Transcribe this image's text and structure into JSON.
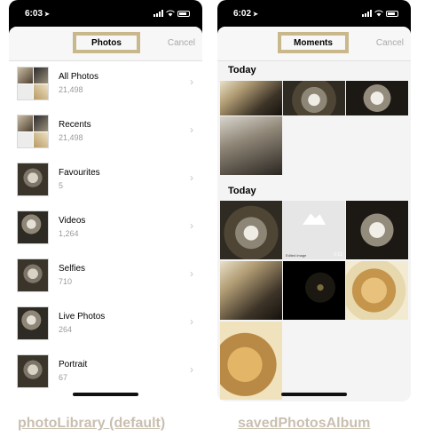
{
  "left_screen": {
    "status": {
      "time": "6:03",
      "location_glyph": "➤"
    },
    "title": "Photos",
    "cancel_label": "Cancel",
    "albums": [
      {
        "name": "All Photos",
        "count": "21,498"
      },
      {
        "name": "Recents",
        "count": "21,498"
      },
      {
        "name": "Favourites",
        "count": "5"
      },
      {
        "name": "Videos",
        "count": "1,264"
      },
      {
        "name": "Selfies",
        "count": "710"
      },
      {
        "name": "Live Photos",
        "count": "264"
      },
      {
        "name": "Portrait",
        "count": "67"
      }
    ],
    "chevron_glyph": "›"
  },
  "right_screen": {
    "status": {
      "time": "6:02",
      "location_glyph": "➤"
    },
    "title": "Moments",
    "cancel_label": "Cancel",
    "sections": [
      {
        "label": "Today"
      },
      {
        "label": "Today"
      }
    ],
    "edited_label": "Edited image",
    "video_duration": "0:12"
  },
  "captions": {
    "left": "photoLibrary (default)",
    "right": "savedPhotosAlbum"
  },
  "colors": {
    "highlight_border": "#c8b88b",
    "caption": "#c9bfb0",
    "cancel": "#a9a9a9",
    "status_bar": "#000000"
  }
}
